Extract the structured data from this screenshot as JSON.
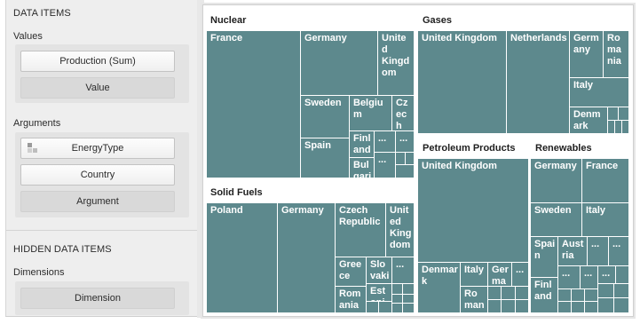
{
  "left_panel": {
    "data_items_title": "DATA ITEMS",
    "values_label": "Values",
    "values_items": [
      "Production (Sum)",
      "Value"
    ],
    "arguments_label": "Arguments",
    "arguments_items": [
      "EnergyType",
      "Country",
      "Argument"
    ],
    "hidden_title": "HIDDEN DATA ITEMS",
    "dimensions_label": "Dimensions",
    "dimensions_items": [
      "Dimension"
    ]
  },
  "treemap": {
    "groups": [
      "Nuclear",
      "Gases",
      "Solid Fuels",
      "Petroleum Products",
      "Renewables"
    ],
    "nuclear": [
      "France",
      "Germany",
      "United Kingdom",
      "Sweden",
      "Belgium",
      "Czech Republic",
      "Spain",
      "Finland",
      "...",
      "...",
      "Bulgaria",
      "..."
    ],
    "gases": [
      "United Kingdom",
      "Netherlands",
      "Germany",
      "Romania",
      "Italy",
      "Denmark"
    ],
    "solid": [
      "Poland",
      "Germany",
      "Czech Republic",
      "United Kingdom",
      "Greece",
      "Slovakia",
      "...",
      "Romania",
      "Estonia"
    ],
    "petroleum": [
      "United Kingdom",
      "Denmark",
      "Italy",
      "Germany",
      "...",
      "Romania"
    ],
    "renewables": [
      "Germany",
      "France",
      "Sweden",
      "Italy",
      "Spain",
      "Austria",
      "...",
      "...",
      "...",
      "...",
      "Finland",
      "..."
    ]
  },
  "colors": {
    "tile": "#5d898d",
    "panel": "#eeeeee"
  }
}
